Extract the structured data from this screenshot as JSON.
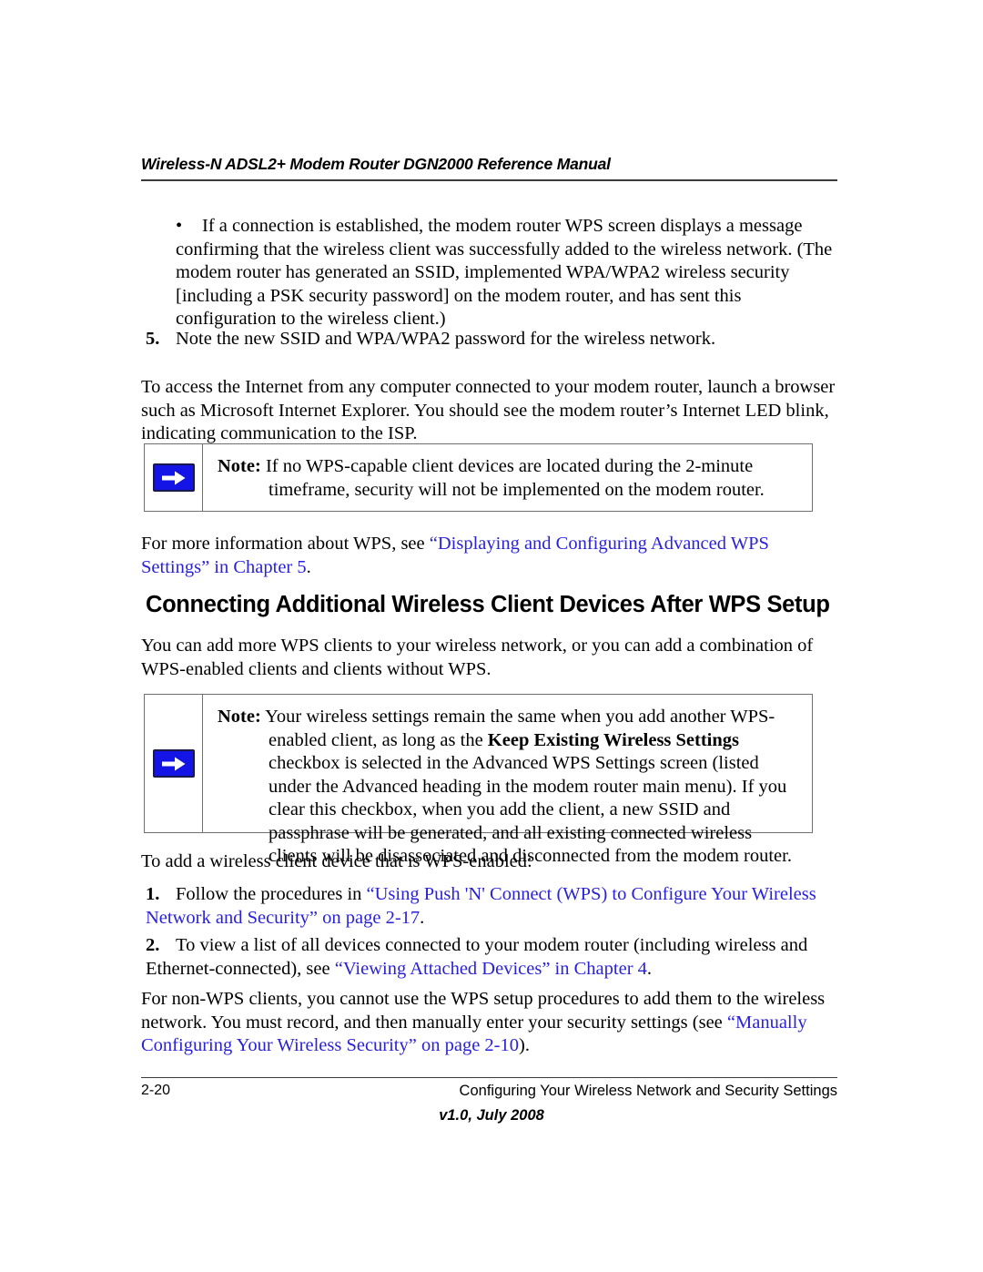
{
  "document": {
    "header_title": "Wireless-N ADSL2+ Modem Router DGN2000 Reference Manual",
    "accent_link_color": "#2a22d8",
    "note_icon_color": "#1414e6"
  },
  "body": {
    "bullet_1": {
      "mark": "•",
      "text": "If a connection is established, the modem router WPS screen displays a message confirming that the wireless client was successfully added to the wireless network. (The modem router has generated an SSID, implemented WPA/WPA2 wireless security [including a PSK security password] on the modem router, and has sent this configuration to the wireless client.)"
    },
    "step_5": {
      "mark": "5.",
      "text": "Note the new SSID and WPA/WPA2 password for the wireless network."
    },
    "para_access": "To access the Internet from any computer connected to your modem router, launch a browser such as Microsoft Internet Explorer. You should see the modem router’s Internet LED blink, indicating communication to the ISP.",
    "note_1": {
      "icon": "blue-right-arrow-icon",
      "lead": "Note:",
      "text": " If no WPS-capable client devices are located during the 2-minute timeframe, security will not be implemented on the modem router."
    },
    "para_more_info": {
      "before": "For more information about WPS, see ",
      "link": "“Displaying and Configuring Advanced WPS Settings” in Chapter 5",
      "after": "."
    },
    "heading": "Connecting Additional Wireless Client Devices After WPS Setup",
    "para_add_clients": "You can add more WPS clients to your wireless network, or you can add a combination of WPS-enabled clients and clients without WPS.",
    "note_2": {
      "icon": "blue-right-arrow-icon",
      "lead": "Note:",
      "text_part_1": " Your wireless settings remain the same when you add another WPS-enabled client, as long as the ",
      "bold_phrase": "Keep Existing Wireless Settings",
      "text_part_2": " checkbox is selected in the Advanced WPS Settings screen (listed under the Advanced heading in the modem router main menu). If you clear this checkbox, when you add the client, a new SSID and passphrase will be generated, and all existing connected wireless clients will be disassociated and disconnected from the modem router."
    },
    "para_to_add": "To add a wireless client device that is WPS-enabled:",
    "step_1": {
      "mark": "1.",
      "before": "Follow the procedures in ",
      "link": "“Using Push 'N' Connect (WPS) to Configure Your Wireless Network and Security” on page 2-17",
      "after": "."
    },
    "step_2": {
      "mark": "2.",
      "before": "To view a list of all devices connected to your modem router (including wireless and Ethernet-connected), see ",
      "link": "“Viewing Attached Devices” in Chapter 4",
      "after": "."
    },
    "para_non_wps": {
      "before": "For non-WPS clients, you cannot use the WPS setup procedures to add them to the wireless network. You must record, and then manually enter your security settings (see ",
      "link": "“Manually Configuring Your Wireless Security” on page 2-10",
      "after": ")."
    }
  },
  "footer": {
    "page_number": "2-20",
    "chapter_title": "Configuring Your Wireless Network and Security Settings",
    "version": "v1.0, July 2008"
  }
}
